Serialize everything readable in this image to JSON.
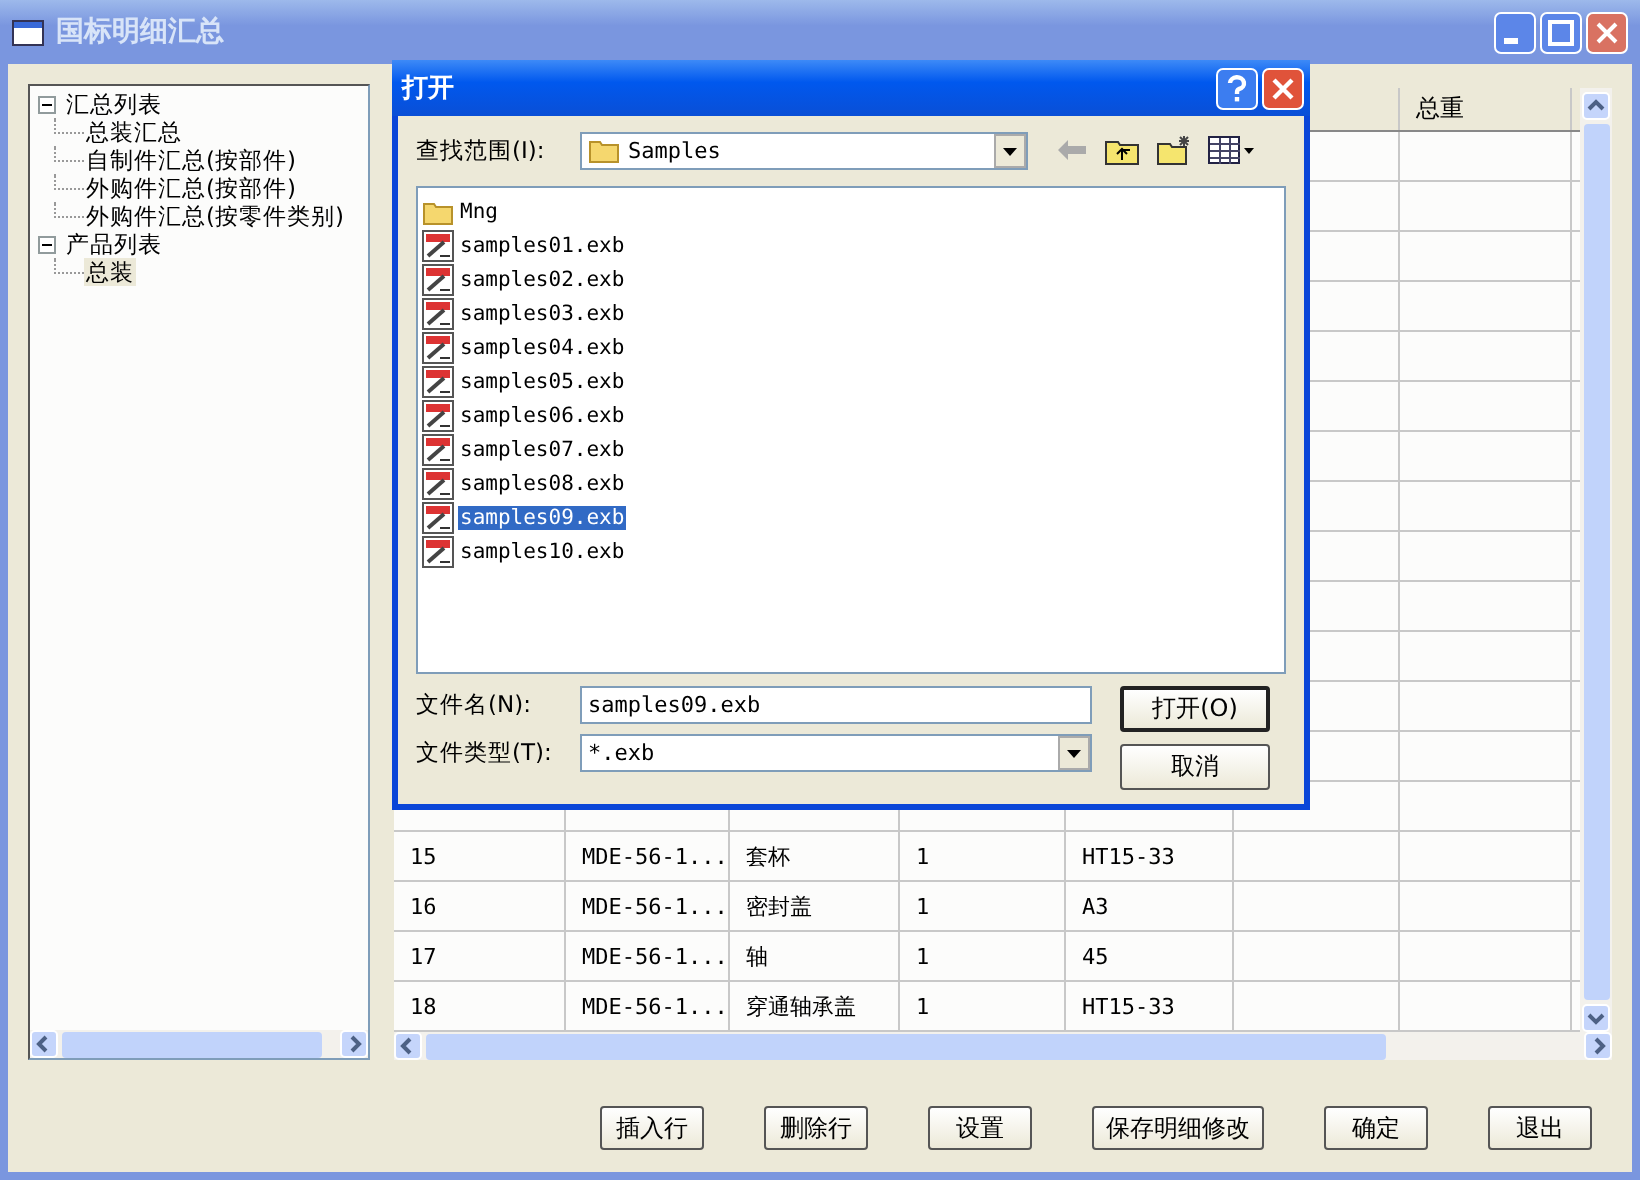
{
  "window": {
    "title": "国标明细汇总"
  },
  "tree": [
    {
      "label": "汇总列表",
      "expanded": true,
      "selected": false,
      "children": [
        {
          "label": "总装汇总",
          "selected": false
        },
        {
          "label": "自制件汇总(按部件)",
          "selected": false
        },
        {
          "label": "外购件汇总(按部件)",
          "selected": false
        },
        {
          "label": "外购件汇总(按零件类别)",
          "selected": false
        }
      ]
    },
    {
      "label": "产品列表",
      "expanded": true,
      "selected": false,
      "children": [
        {
          "label": "总装",
          "selected": true
        }
      ]
    }
  ],
  "table": {
    "column_7": "总重",
    "rows": [
      [
        "15",
        "MDE-56-1...",
        "套杯",
        "1",
        "HT15-33"
      ],
      [
        "16",
        "MDE-56-1...",
        "密封盖",
        "1",
        "A3"
      ],
      [
        "17",
        "MDE-56-1...",
        "轴",
        "1",
        "45"
      ],
      [
        "18",
        "MDE-56-1...",
        "穿通轴承盖",
        "1",
        "HT15-33"
      ]
    ]
  },
  "buttons": [
    "插入行",
    "删除行",
    "设置",
    "保存明细修改",
    "确定",
    "退出"
  ],
  "dialog": {
    "title": "打开",
    "look_in_label": "查找范围(I):",
    "look_in": "Samples",
    "files": [
      {
        "kind": "folder",
        "name": "Mng",
        "selected": false
      },
      {
        "kind": "file",
        "name": "samples01.exb",
        "selected": false
      },
      {
        "kind": "file",
        "name": "samples02.exb",
        "selected": false
      },
      {
        "kind": "file",
        "name": "samples03.exb",
        "selected": false
      },
      {
        "kind": "file",
        "name": "samples04.exb",
        "selected": false
      },
      {
        "kind": "file",
        "name": "samples05.exb",
        "selected": false
      },
      {
        "kind": "file",
        "name": "samples06.exb",
        "selected": false
      },
      {
        "kind": "file",
        "name": "samples07.exb",
        "selected": false
      },
      {
        "kind": "file",
        "name": "samples08.exb",
        "selected": false
      },
      {
        "kind": "file",
        "name": "samples09.exb",
        "selected": true
      },
      {
        "kind": "file",
        "name": "samples10.exb",
        "selected": false
      }
    ],
    "file_name_label": "文件名(N):",
    "file_name": "samples09.exb",
    "file_type_label": "文件类型(T):",
    "file_type": "*.exb",
    "open_button": "打开(O)",
    "cancel_button": "取消"
  }
}
